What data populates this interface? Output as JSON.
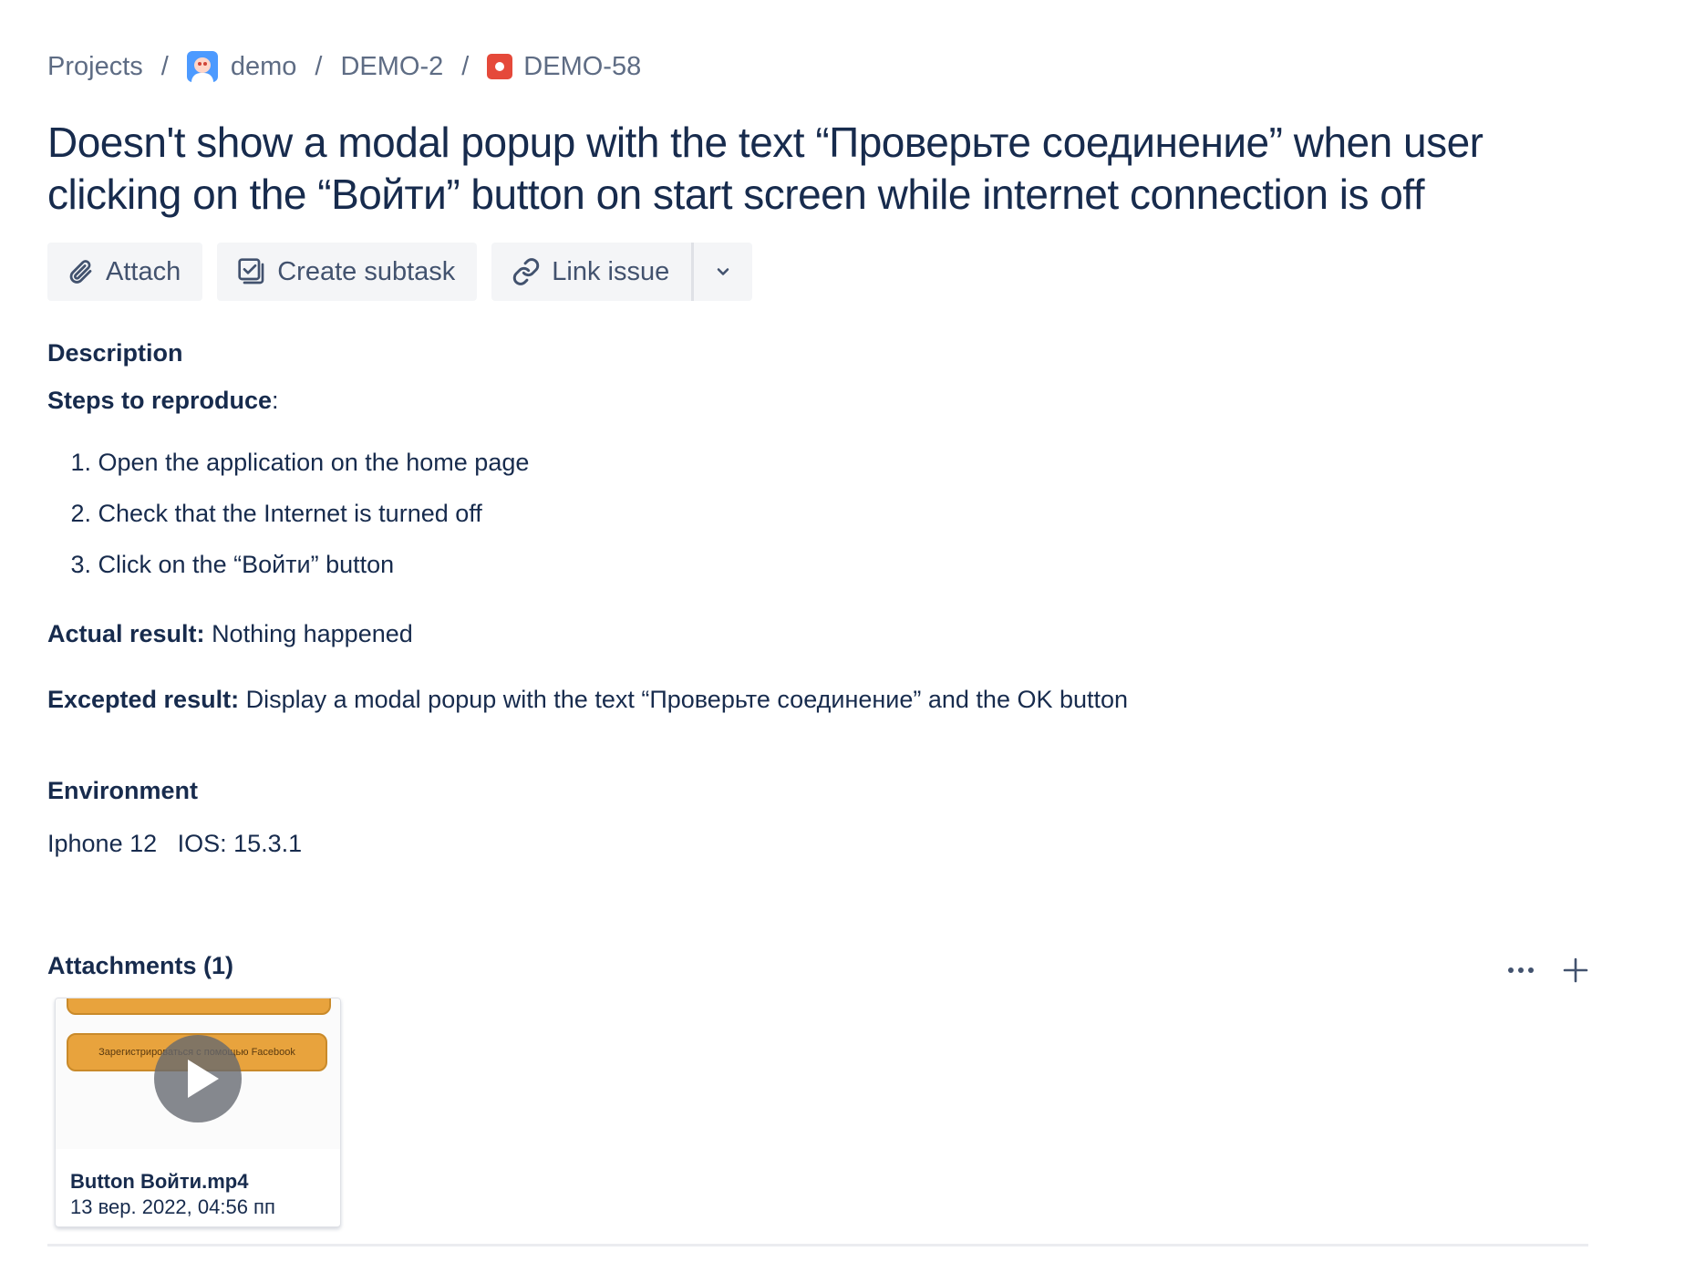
{
  "breadcrumb": {
    "projects": "Projects",
    "project": "demo",
    "parent": "DEMO-2",
    "issue": "DEMO-58",
    "separator": "/"
  },
  "issue": {
    "title": "Doesn't show a modal popup with the text “Проверьте соединение” when user clicking on the “Войти” button on start screen while internet connection is off"
  },
  "toolbar": {
    "attach_label": "Attach",
    "create_subtask_label": "Create subtask",
    "link_issue_label": "Link issue"
  },
  "description": {
    "heading": "Description",
    "steps_heading": "Steps to reproduce",
    "steps_colon": ":",
    "steps": [
      {
        "num": "1.",
        "text": "Open the application on the home page"
      },
      {
        "num": "2.",
        "text": "Check that the Internet is turned off"
      },
      {
        "num": "3.",
        "text": "Click on the “Войти” button"
      }
    ],
    "actual_label": "Actual result:",
    "actual_text": "Nothing happened",
    "expected_label": "Excepted result:",
    "expected_text": "Display a modal popup with the text “Проверьте соединение” and the OK button"
  },
  "environment": {
    "heading": "Environment",
    "value": "Iphone 12   IOS: 15.3.1"
  },
  "attachments": {
    "heading": "Attachments (1)",
    "items": [
      {
        "file_name": "Button Войти.mp4",
        "date": "13 вер. 2022, 04:56 пп",
        "thumb_text": "Зарегистрироваться с помощью Facebook"
      }
    ]
  },
  "colors": {
    "text": "#172b4d",
    "muted": "#5e6c84",
    "button_bg": "#f4f5f7",
    "bug": "#e5493a"
  }
}
